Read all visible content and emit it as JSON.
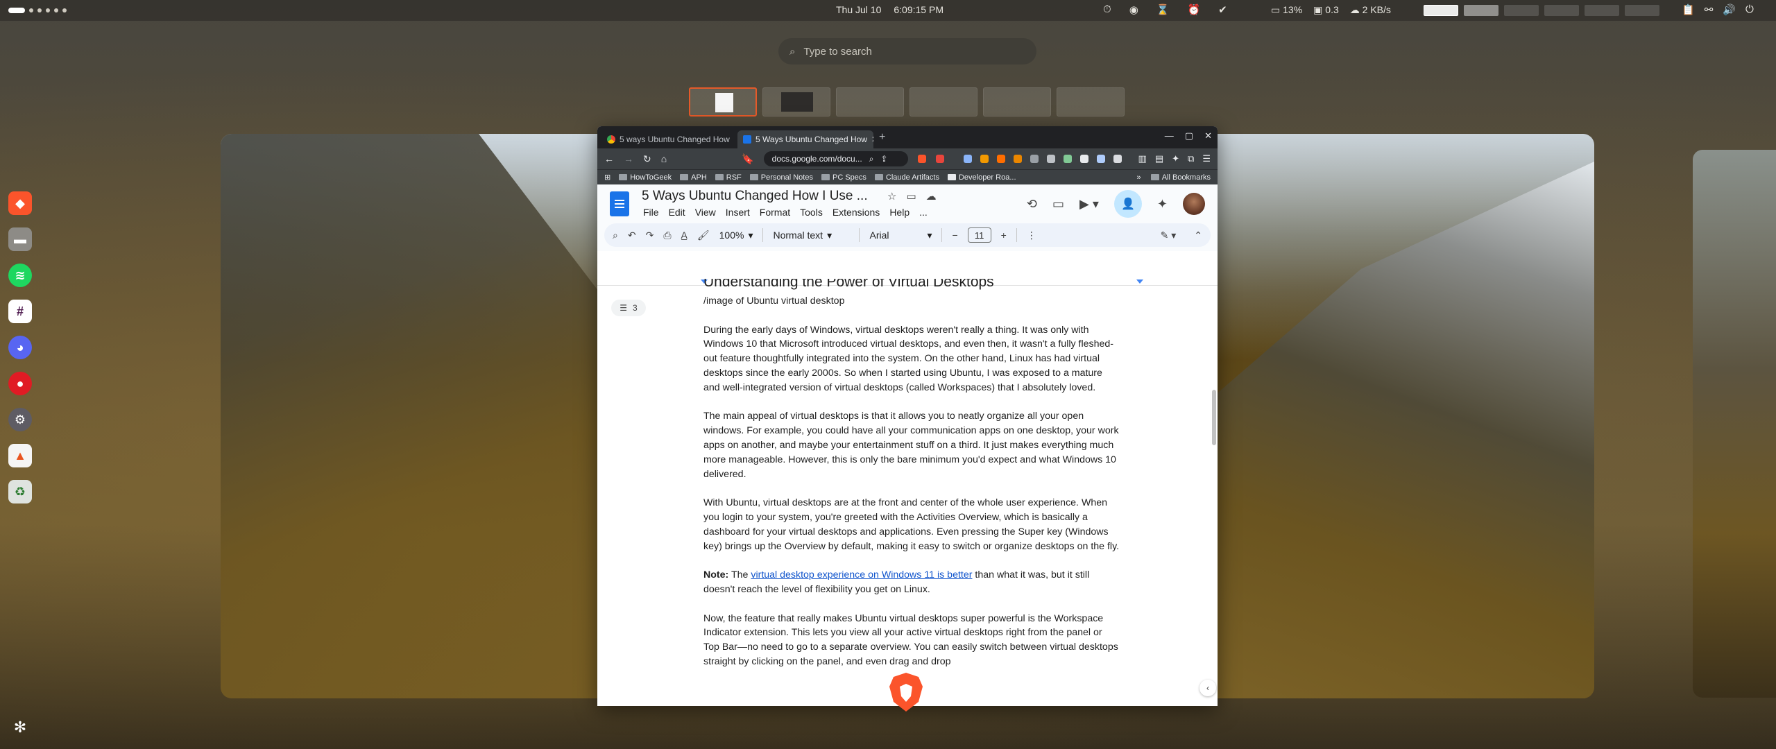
{
  "topbar": {
    "date": "Thu Jul 10",
    "time": "6:09:15 PM",
    "cpu": "13%",
    "load": "0.3",
    "net": "2 KB/s"
  },
  "search": {
    "placeholder": "Type to search"
  },
  "browser": {
    "tabs": [
      {
        "label": "5 ways Ubuntu Changed How",
        "active": false
      },
      {
        "label": "5 Ways Ubuntu Changed How",
        "active": true
      }
    ],
    "url": "docs.google.com/docu...",
    "bookmarks": [
      "HowToGeek",
      "APH",
      "RSF",
      "Personal Notes",
      "PC Specs",
      "Claude Artifacts",
      "Developer Roa..."
    ],
    "all_bookmarks": "All Bookmarks"
  },
  "docs": {
    "title": "5 Ways Ubuntu Changed How I Use ...",
    "menus": [
      "File",
      "Edit",
      "View",
      "Insert",
      "Format",
      "Tools",
      "Extensions",
      "Help",
      "..."
    ],
    "zoom": "100%",
    "style": "Normal text",
    "font": "Arial",
    "font_size": "11",
    "outline_count": "3"
  },
  "content": {
    "heading": "Understanding the Power of Virtual Desktops",
    "image_note": "/image of Ubuntu virtual desktop",
    "p1": "During the early days of Windows, virtual desktops weren't really a thing. It was only with Windows 10 that Microsoft introduced virtual desktops, and even then, it wasn't a fully fleshed-out feature thoughtfully integrated into the system. On the other hand, Linux has had virtual desktops since the early 2000s. So when I started using Ubuntu, I was exposed to a mature and well-integrated version of virtual desktops (called Workspaces) that I absolutely loved.",
    "p2": "The main appeal of virtual desktops is that it allows you to neatly organize all your open windows. For example, you could have all your communication apps on one desktop, your work apps on another, and maybe your entertainment stuff on a third. It just makes everything much more manageable. However, this is only the bare minimum you'd expect and what Windows 10 delivered.",
    "p3": "With Ubuntu, virtual desktops are at the front and center of the whole user experience. When you login to your system, you're greeted with the Activities Overview, which is basically a dashboard for your virtual desktops and applications. Even pressing the Super key (Windows key) brings up the Overview by default, making it easy to switch or organize desktops on the fly.",
    "note_label": "Note:",
    "note_pre": " The ",
    "note_link": "virtual desktop experience on Windows 11 is better",
    "note_post": " than what it was, but it still doesn't reach the level of flexibility you get on Linux.",
    "p5": "Now, the feature that really makes Ubuntu virtual desktops super powerful is the Workspace Indicator extension. This lets you view all your active virtual desktops right from the panel or Top Bar—no need to go to a separate overview. You can easily switch between virtual desktops straight by clicking on the panel, and even drag and drop"
  },
  "icons": {
    "dock": [
      "brave-icon",
      "files-icon",
      "spotify-icon",
      "slack-icon",
      "discord-icon",
      "recorder-icon",
      "settings-icon",
      "app-center-icon",
      "trash-icon"
    ]
  },
  "colors": {
    "docs_blue": "#1a73e8",
    "link": "#1155cc",
    "brave_orange": "#fb542b",
    "active_ws": "#e65a29"
  }
}
